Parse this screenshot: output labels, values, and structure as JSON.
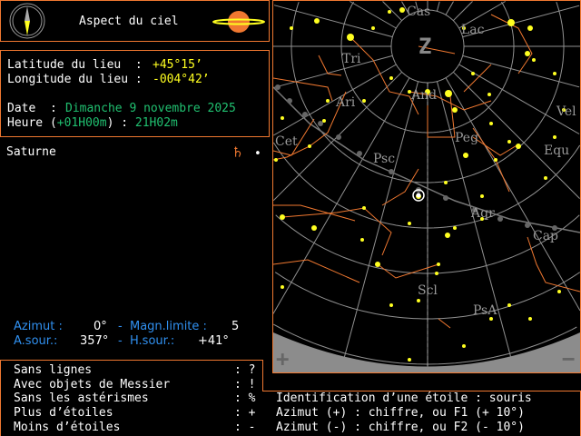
{
  "header": {
    "title": "Aspect du ciel",
    "compass_icon": "compass-icon",
    "planet_icon": "saturn-icon"
  },
  "location": {
    "latitude_label": "Latitude du lieu  :",
    "latitude_value": "+45°15’",
    "longitude_label": "Longitude du lieu :",
    "longitude_value": "-004°42’",
    "date_label": "Date  :",
    "date_value": "Dimanche 9 novembre 2025",
    "time_label_open": "Heure (",
    "timezone": "+01H00m",
    "time_label_close": ") :",
    "time_value": "21H02m"
  },
  "planet": {
    "name": "Saturne",
    "symbol": "♄",
    "dot": "•"
  },
  "view": {
    "azimut_label": "Azimut :",
    "azimut_value": "0°",
    "sep1": "-",
    "magn_label": "Magn.limite :",
    "magn_value": "5",
    "asour_label": "A.sour.:",
    "asour_value": "357°",
    "sep2": "-",
    "hsour_label": "H.sour.:",
    "hsour_value": "+41°"
  },
  "shortcuts": [
    {
      "label": "Sans lignes",
      "key": ": ?"
    },
    {
      "label": "Avec objets de Messier",
      "key": ": !"
    },
    {
      "label": "Sans les astérismes",
      "key": ": %"
    },
    {
      "label": "Plus d’étoiles",
      "key": ": +"
    },
    {
      "label": "Moins d’étoiles",
      "key": ": -"
    }
  ],
  "help": [
    "Identification d’une étoile : souris",
    "Azimut (+) : chiffre, ou F1 (+ 10°)",
    "Azimut (-) : chiffre, ou F2 (- 10°)"
  ],
  "sky": {
    "zenith_label": "Z",
    "zoom_in": "+",
    "zoom_out": "−",
    "constellations": [
      "Cas",
      "Lac",
      "Tri",
      "And",
      "Ari",
      "Peg",
      "Cet",
      "Psc",
      "Equ",
      "Vel",
      "Aqr",
      "Cap",
      "Scl",
      "PsA"
    ]
  },
  "colors": {
    "border": "#f07830",
    "star": "#ffff20",
    "grid": "#909090",
    "horizon": "#8c8c8c",
    "lines": "#f07830",
    "info_blue": "#3090f0",
    "info_green": "#20c070"
  }
}
